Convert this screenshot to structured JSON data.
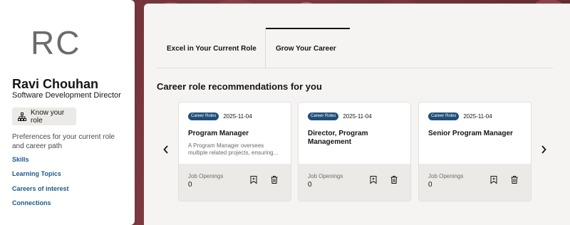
{
  "profile": {
    "initials": "RC",
    "name": "Ravi Chouhan",
    "title": "Software Development Director",
    "know_role_label": "Know your role",
    "preferences_text": "Preferences for your current role and career path",
    "links": [
      {
        "label": "Skills"
      },
      {
        "label": "Learning Topics"
      },
      {
        "label": "Careers of interest"
      },
      {
        "label": "Connections"
      }
    ]
  },
  "tabs": [
    {
      "label": "Excel in Your Current Role",
      "selected": false
    },
    {
      "label": "Grow Your Career",
      "selected": true
    }
  ],
  "section_title": "Career role recommendations for you",
  "cards": [
    {
      "badge": "Career Roles",
      "date": "2025-11-04",
      "title": "Program Manager",
      "description": "A Program Manager oversees multiple related projects, ensuring...",
      "openings_label": "Job Openings",
      "openings_value": "0"
    },
    {
      "badge": "Career Roles",
      "date": "2025-11-04",
      "title": "Director, Program Management",
      "description": "",
      "openings_label": "Job Openings",
      "openings_value": "0"
    },
    {
      "badge": "Career Roles",
      "date": "2025-11-04",
      "title": "Senior Program Manager",
      "description": "",
      "openings_label": "Job Openings",
      "openings_value": "0"
    }
  ],
  "icons": {
    "know_role": "org-chart-icon",
    "prev": "chevron-left-icon",
    "next": "chevron-right-icon",
    "bookmark": "bookmark-icon",
    "delete": "trash-icon"
  },
  "colors": {
    "banner": "#6b2f33",
    "badge": "#1f4e79",
    "link": "#1d5a8a"
  }
}
